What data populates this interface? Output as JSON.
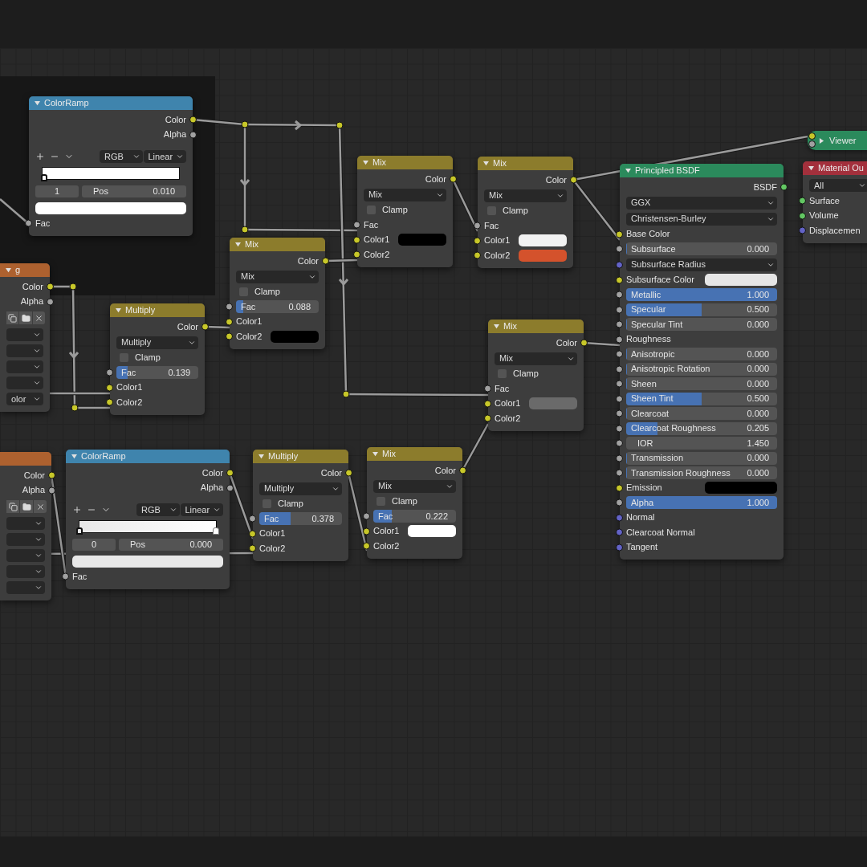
{
  "nodes": [
    {
      "title": "ColorRamp",
      "color": "#3f84ad",
      "expanded": true,
      "rows": [
        {
          "kind": "output",
          "label": "Color",
          "socket": {
            "color": "#c7c729"
          }
        },
        {
          "kind": "output",
          "label": "Alpha",
          "socket": {
            "color": "#a1a1a1"
          }
        },
        {
          "kind": "ramp_tools",
          "mode": "RGB",
          "interpolation": "Linear"
        },
        {
          "kind": "ramp",
          "stops": [
            {
              "level": 0.01,
              "selected": true,
              "color": "#ffffff"
            }
          ]
        },
        {
          "kind": "stop_fields",
          "index": "1",
          "label": "Pos",
          "value": "0.010"
        },
        {
          "kind": "color_bar",
          "color": "#ffffff"
        },
        {
          "kind": "input",
          "label": "Fac",
          "socket": {
            "color": "#a1a1a1"
          }
        }
      ]
    },
    {
      "title": "g",
      "color": "#ad612f",
      "expanded": true,
      "rows": [
        {
          "kind": "output",
          "label": "Color",
          "socket": {
            "color": "#c7c729"
          }
        },
        {
          "kind": "output",
          "label": "Alpha",
          "socket": {
            "color": "#a1a1a1"
          }
        },
        {
          "kind": "icon_row"
        },
        {
          "kind": "select"
        },
        {
          "kind": "select"
        },
        {
          "kind": "select"
        },
        {
          "kind": "select"
        },
        {
          "kind": "select",
          "value": "olor"
        }
      ]
    },
    {
      "title": "Multiply",
      "color": "#8c7c2c",
      "expanded": true,
      "rows": [
        {
          "kind": "output",
          "label": "Color",
          "socket": {
            "color": "#c7c729"
          }
        },
        {
          "kind": "select",
          "value": "Multiply"
        },
        {
          "kind": "checkbox",
          "label": "Clamp",
          "checked": false
        },
        {
          "kind": "slider",
          "label": "Fac",
          "value": "0.139",
          "level": 0.139,
          "socket": {
            "color": "#a1a1a1"
          }
        },
        {
          "kind": "input",
          "label": "Color1",
          "socket": {
            "color": "#c7c729"
          }
        },
        {
          "kind": "input",
          "label": "Color2",
          "socket": {
            "color": "#c7c729"
          }
        }
      ]
    },
    {
      "title": "Mix",
      "color": "#8c7c2c",
      "expanded": true,
      "rows": [
        {
          "kind": "output",
          "label": "Color",
          "socket": {
            "color": "#c7c729"
          }
        },
        {
          "kind": "select",
          "value": "Mix"
        },
        {
          "kind": "checkbox",
          "label": "Clamp",
          "checked": false
        },
        {
          "kind": "slider",
          "label": "Fac",
          "value": "0.088",
          "level": 0.088,
          "socket": {
            "color": "#a1a1a1"
          }
        },
        {
          "kind": "input",
          "label": "Color1",
          "socket": {
            "color": "#c7c729"
          }
        },
        {
          "kind": "swatch",
          "label": "Color2",
          "color": "#000000",
          "socket": {
            "color": "#c7c729"
          }
        }
      ]
    },
    {
      "title": "Mix",
      "color": "#8c7c2c",
      "expanded": true,
      "rows": [
        {
          "kind": "output",
          "label": "Color",
          "socket": {
            "color": "#c7c729"
          }
        },
        {
          "kind": "select",
          "value": "Mix"
        },
        {
          "kind": "checkbox",
          "label": "Clamp",
          "checked": false
        },
        {
          "kind": "input",
          "label": "Fac",
          "socket": {
            "color": "#a1a1a1"
          }
        },
        {
          "kind": "swatch",
          "label": "Color1",
          "color": "#000000",
          "socket": {
            "color": "#c7c729"
          }
        },
        {
          "kind": "input",
          "label": "Color2",
          "socket": {
            "color": "#c7c729"
          }
        }
      ]
    },
    {
      "title": "Mix",
      "color": "#8c7c2c",
      "expanded": true,
      "rows": [
        {
          "kind": "output",
          "label": "Color",
          "socket": {
            "color": "#c7c729"
          }
        },
        {
          "kind": "select",
          "value": "Mix"
        },
        {
          "kind": "checkbox",
          "label": "Clamp",
          "checked": false
        },
        {
          "kind": "input",
          "label": "Fac",
          "socket": {
            "color": "#a1a1a1"
          }
        },
        {
          "kind": "swatch",
          "label": "Color1",
          "color": "#f2f2f2",
          "socket": {
            "color": "#c7c729"
          }
        },
        {
          "kind": "swatch",
          "label": "Color2",
          "color": "#d4522c",
          "socket": {
            "color": "#c7c729"
          }
        }
      ]
    },
    {
      "title": "Mix",
      "color": "#8c7c2c",
      "expanded": true,
      "rows": [
        {
          "kind": "output",
          "label": "Color",
          "socket": {
            "color": "#c7c729"
          }
        },
        {
          "kind": "select",
          "value": "Mix"
        },
        {
          "kind": "checkbox",
          "label": "Clamp",
          "checked": false
        },
        {
          "kind": "input",
          "label": "Fac",
          "socket": {
            "color": "#a1a1a1"
          }
        },
        {
          "kind": "swatch",
          "label": "Color1",
          "color": "#6a6a6a",
          "socket": {
            "color": "#c7c729"
          }
        },
        {
          "kind": "input",
          "label": "Color2",
          "socket": {
            "color": "#c7c729"
          }
        }
      ]
    },
    {
      "color": "#ad612f",
      "expanded": true,
      "rows": [
        {
          "kind": "output",
          "label": "Color",
          "socket": {
            "color": "#c7c729"
          }
        },
        {
          "kind": "output",
          "label": "Alpha",
          "socket": {
            "color": "#a1a1a1"
          }
        },
        {
          "kind": "icon_row"
        },
        {
          "kind": "select"
        },
        {
          "kind": "select"
        },
        {
          "kind": "select"
        },
        {
          "kind": "select"
        },
        {
          "kind": "select"
        }
      ]
    },
    {
      "title": "ColorRamp",
      "color": "#3f84ad",
      "expanded": true,
      "rows": [
        {
          "kind": "output",
          "label": "Color",
          "socket": {
            "color": "#c7c729"
          }
        },
        {
          "kind": "output",
          "label": "Alpha",
          "socket": {
            "color": "#a1a1a1"
          }
        },
        {
          "kind": "ramp_tools",
          "mode": "RGB",
          "interpolation": "Linear"
        },
        {
          "kind": "ramp",
          "stops": [
            {
              "level": 0,
              "selected": true,
              "color": "#e8e8e8"
            },
            {
              "level": 1,
              "selected": false,
              "color": "#ffffff"
            }
          ]
        },
        {
          "kind": "stop_fields",
          "index": "0",
          "label": "Pos",
          "value": "0.000"
        },
        {
          "kind": "color_bar",
          "color": "#e8e8e8"
        },
        {
          "kind": "input",
          "label": "Fac",
          "socket": {
            "color": "#a1a1a1"
          }
        }
      ]
    },
    {
      "title": "Multiply",
      "color": "#8c7c2c",
      "expanded": true,
      "rows": [
        {
          "kind": "output",
          "label": "Color",
          "socket": {
            "color": "#c7c729"
          }
        },
        {
          "kind": "select",
          "value": "Multiply"
        },
        {
          "kind": "checkbox",
          "label": "Clamp",
          "checked": false
        },
        {
          "kind": "slider",
          "label": "Fac",
          "value": "0.378",
          "level": 0.378,
          "socket": {
            "color": "#a1a1a1"
          }
        },
        {
          "kind": "input",
          "label": "Color1",
          "socket": {
            "color": "#c7c729"
          }
        },
        {
          "kind": "input",
          "label": "Color2",
          "socket": {
            "color": "#c7c729"
          }
        }
      ]
    },
    {
      "title": "Mix",
      "color": "#8c7c2c",
      "expanded": true,
      "rows": [
        {
          "kind": "output",
          "label": "Color",
          "socket": {
            "color": "#c7c729"
          }
        },
        {
          "kind": "select",
          "value": "Mix"
        },
        {
          "kind": "checkbox",
          "label": "Clamp",
          "checked": false
        },
        {
          "kind": "slider",
          "label": "Fac",
          "value": "0.222",
          "level": 0.222,
          "socket": {
            "color": "#a1a1a1"
          }
        },
        {
          "kind": "swatch",
          "label": "Color1",
          "color": "#ffffff",
          "socket": {
            "color": "#c7c729"
          }
        },
        {
          "kind": "input",
          "label": "Color2",
          "socket": {
            "color": "#c7c729"
          }
        }
      ]
    },
    {
      "title": "Principled BSDF",
      "color": "#2b8a5c",
      "expanded": true,
      "rows": [
        {
          "kind": "output",
          "label": "BSDF",
          "socket": {
            "color": "#63c763"
          }
        },
        {
          "kind": "select",
          "value": "GGX"
        },
        {
          "kind": "select",
          "value": "Christensen-Burley"
        },
        {
          "kind": "input",
          "label": "Base Color",
          "socket": {
            "color": "#c7c729"
          }
        },
        {
          "kind": "slider",
          "label": "Subsurface",
          "value": "0.000",
          "level": 0,
          "socket": {
            "color": "#a1a1a1"
          }
        },
        {
          "kind": "select",
          "value": "Subsurface Radius",
          "socket": {
            "color": "#6363c7"
          }
        },
        {
          "kind": "swatch",
          "label": "Subsurface Color",
          "color": "#e6e6e6",
          "socket": {
            "color": "#c7c729"
          }
        },
        {
          "kind": "slider",
          "label": "Metallic",
          "value": "1.000",
          "level": 1,
          "socket": {
            "color": "#a1a1a1"
          }
        },
        {
          "kind": "slider",
          "label": "Specular",
          "value": "0.500",
          "level": 0.5,
          "socket": {
            "color": "#a1a1a1"
          }
        },
        {
          "kind": "slider",
          "label": "Specular Tint",
          "value": "0.000",
          "level": 0,
          "socket": {
            "color": "#a1a1a1"
          }
        },
        {
          "kind": "input",
          "label": "Roughness",
          "socket": {
            "color": "#a1a1a1"
          }
        },
        {
          "kind": "slider",
          "label": "Anisotropic",
          "value": "0.000",
          "level": 0,
          "socket": {
            "color": "#a1a1a1"
          }
        },
        {
          "kind": "slider",
          "label": "Anisotropic Rotation",
          "value": "0.000",
          "level": 0,
          "socket": {
            "color": "#a1a1a1"
          }
        },
        {
          "kind": "slider",
          "label": "Sheen",
          "value": "0.000",
          "level": 0,
          "socket": {
            "color": "#a1a1a1"
          }
        },
        {
          "kind": "slider",
          "label": "Sheen Tint",
          "value": "0.500",
          "level": 0.5,
          "socket": {
            "color": "#a1a1a1"
          }
        },
        {
          "kind": "slider",
          "label": "Clearcoat",
          "value": "0.000",
          "level": 0,
          "socket": {
            "color": "#a1a1a1"
          }
        },
        {
          "kind": "slider",
          "label": "Clearcoat Roughness",
          "value": "0.205",
          "level": 0.205,
          "socket": {
            "color": "#a1a1a1"
          }
        },
        {
          "kind": "number",
          "label": "IOR",
          "value": "1.450",
          "socket": {
            "color": "#a1a1a1"
          }
        },
        {
          "kind": "slider",
          "label": "Transmission",
          "value": "0.000",
          "level": 0,
          "socket": {
            "color": "#a1a1a1"
          }
        },
        {
          "kind": "slider",
          "label": "Transmission Roughness",
          "value": "0.000",
          "level": 0,
          "socket": {
            "color": "#a1a1a1"
          }
        },
        {
          "kind": "swatch",
          "label": "Emission",
          "color": "#000000",
          "socket": {
            "color": "#c7c729"
          }
        },
        {
          "kind": "slider",
          "label": "Alpha",
          "value": "1.000",
          "level": 1,
          "socket": {
            "color": "#a1a1a1"
          }
        },
        {
          "kind": "input",
          "label": "Normal",
          "socket": {
            "color": "#6363c7"
          }
        },
        {
          "kind": "input",
          "label": "Clearcoat Normal",
          "socket": {
            "color": "#6363c7"
          }
        },
        {
          "kind": "input",
          "label": "Tangent",
          "socket": {
            "color": "#6363c7"
          }
        }
      ]
    },
    {
      "title": "Viewer",
      "color": "#2b8a5c",
      "expanded": false,
      "sockets": [
        {
          "color": "#c7c729"
        },
        {
          "color": "#a1a1a1"
        }
      ]
    },
    {
      "title": "Material Ou",
      "color": "#a3303c",
      "expanded": true,
      "rows": [
        {
          "kind": "select",
          "value": "All"
        },
        {
          "kind": "input",
          "label": "Surface",
          "socket": {
            "color": "#63c763"
          }
        },
        {
          "kind": "input",
          "label": "Volume",
          "socket": {
            "color": "#63c763"
          }
        },
        {
          "kind": "input",
          "label": "Displacemen",
          "socket": {
            "color": "#6363c7"
          }
        }
      ]
    }
  ]
}
